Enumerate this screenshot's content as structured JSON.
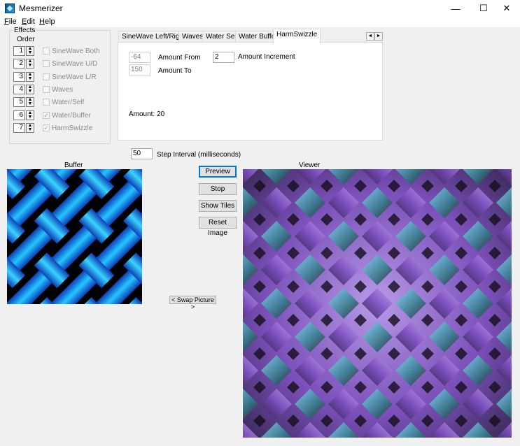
{
  "window": {
    "title": "Mesmerizer",
    "minimize_glyph": "—",
    "maximize_glyph": "☐",
    "close_glyph": "✕"
  },
  "menu": {
    "items": [
      {
        "label": "File",
        "accel": "F",
        "rest": "ile"
      },
      {
        "label": "Edit",
        "accel": "E",
        "rest": "dit"
      },
      {
        "label": "Help",
        "accel": "H",
        "rest": "elp"
      }
    ]
  },
  "effects": {
    "group_label": "Effects",
    "order_label": "Order",
    "items": [
      {
        "order": "1",
        "label": "SineWave Both",
        "checked": false
      },
      {
        "order": "2",
        "label": "SineWave U/D",
        "checked": false
      },
      {
        "order": "3",
        "label": "SineWave L/R",
        "checked": false
      },
      {
        "order": "4",
        "label": "Waves",
        "checked": false
      },
      {
        "order": "5",
        "label": "Water/Self",
        "checked": false
      },
      {
        "order": "6",
        "label": "Water/Buffer",
        "checked": true
      },
      {
        "order": "7",
        "label": "HarmSwizzle",
        "checked": true
      }
    ]
  },
  "tabs": {
    "items": [
      "SineWave Left/Right",
      "Waves",
      "Water Self",
      "Water Buffer",
      "HarmSwizzle"
    ],
    "active": "HarmSwizzle",
    "scroll_left": "◄",
    "scroll_right": "►"
  },
  "harmswizzle": {
    "amount_from_value": "-64",
    "amount_from_label": "Amount From",
    "amount_to_value": "150",
    "amount_to_label": "Amount To",
    "amount_increment_value": "2",
    "amount_increment_label": "Amount Increment",
    "amount_status": "Amount: 20"
  },
  "step": {
    "value": "50",
    "label": "Step Interval (milliseconds)"
  },
  "buffer": {
    "label": "Buffer"
  },
  "viewer": {
    "label": "Viewer"
  },
  "buttons": {
    "preview": "Preview",
    "stop": "Stop",
    "show_tiles": "Show Tiles",
    "reset_image": "Reset Image",
    "swap_picture": "< Swap Picture >"
  },
  "colors": {
    "buffer_cyan": "#1fb8ff",
    "buffer_blue": "#0a3db0",
    "viewer_purple": "#9a6fd6",
    "viewer_teal": "#6fd3cf",
    "viewer_sky": "#8fc8ff"
  }
}
